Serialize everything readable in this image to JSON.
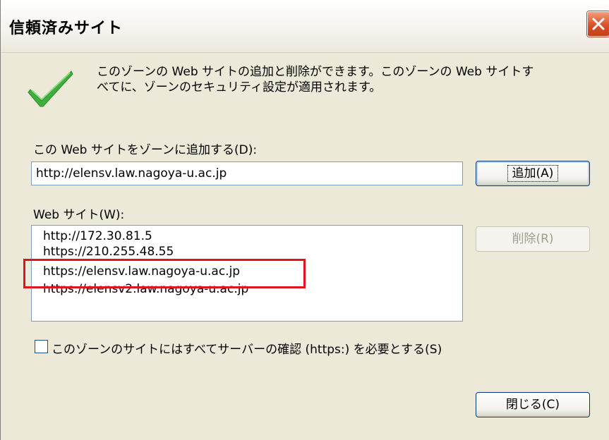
{
  "window": {
    "title": "信頼済みサイト"
  },
  "description": {
    "line1": "このゾーンの Web サイトの追加と削除ができます。このゾーンの Web サイトす",
    "line2": "べてに、ゾーンのセキュリティ設定が適用されます。"
  },
  "add_site": {
    "label": "この Web サイトをゾーンに追加する(D):",
    "value": "http://elensv.law.nagoya-u.ac.jp",
    "button_label": "追加(A)"
  },
  "site_list": {
    "label": "Web サイト(W):",
    "items": [
      "http://172.30.81.5",
      "https://210.255.48.55",
      "https://elensv.law.nagoya-u.ac.jp",
      "https://elensv2.law.nagoya-u.ac.jp"
    ],
    "remove_button_label": "削除(R)"
  },
  "require_https": {
    "label": "このゾーンのサイトにはすべてサーバーの確認 (https:) を必要とする(S)",
    "checked": false
  },
  "close_button_label": "閉じる(C)",
  "colors": {
    "highlight_box": "#e0141a",
    "dialog_bg": "#ece9d8",
    "check_green": "#3fae3c"
  },
  "icons": {
    "status": "check-icon",
    "window_close": "close-icon"
  }
}
